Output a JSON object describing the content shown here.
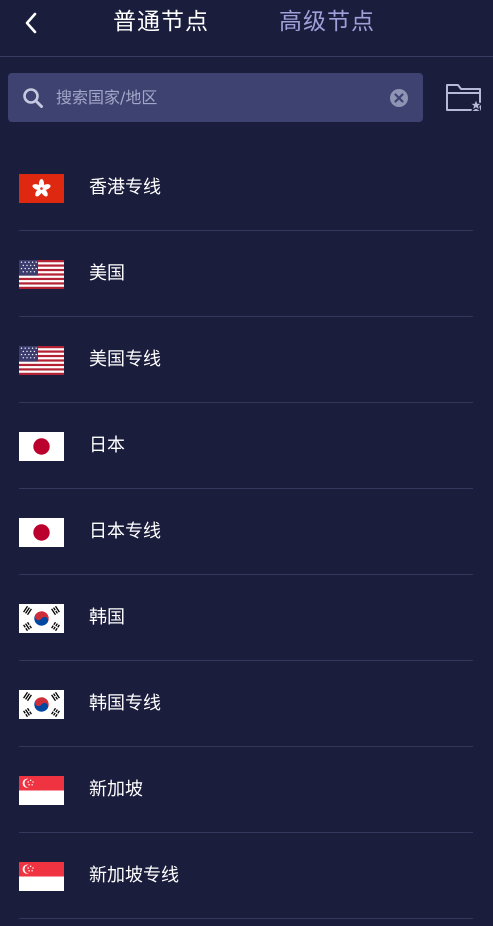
{
  "header": {
    "tabs": [
      {
        "label": "普通节点",
        "active": true
      },
      {
        "label": "高级节点",
        "active": false
      }
    ]
  },
  "search": {
    "placeholder": "搜索国家/地区"
  },
  "regions": [
    {
      "label": "香港专线",
      "flag": "hk-flag-icon"
    },
    {
      "label": "美国",
      "flag": "us-flag-icon"
    },
    {
      "label": "美国专线",
      "flag": "us-flag-icon"
    },
    {
      "label": "日本",
      "flag": "jp-flag-icon"
    },
    {
      "label": "日本专线",
      "flag": "jp-flag-icon"
    },
    {
      "label": "韩国",
      "flag": "kr-flag-icon"
    },
    {
      "label": "韩国专线",
      "flag": "kr-flag-icon"
    },
    {
      "label": "新加坡",
      "flag": "sg-flag-icon"
    },
    {
      "label": "新加坡专线",
      "flag": "sg-flag-icon"
    }
  ],
  "colors": {
    "background": "#1b1d3d",
    "search_bg": "#3e4270",
    "active_tab": "#ffffff",
    "inactive_tab": "#9f9fd9",
    "divider": "#34375c"
  }
}
